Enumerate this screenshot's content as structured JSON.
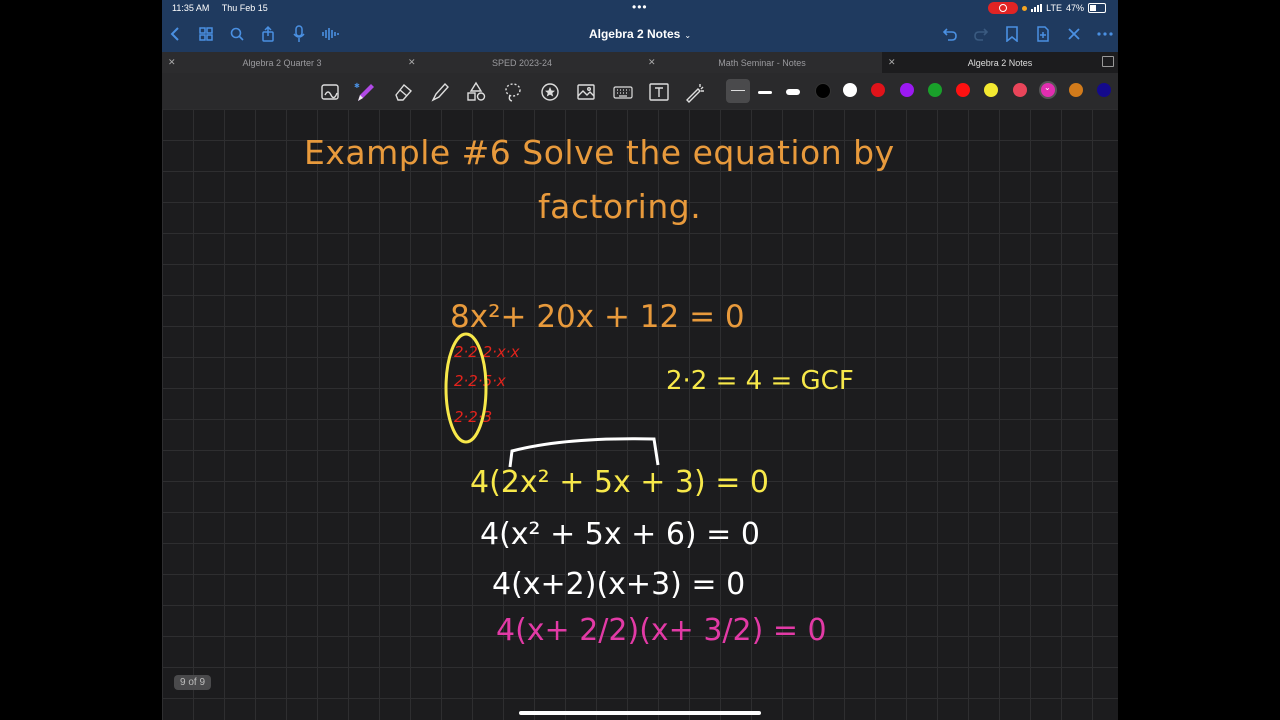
{
  "status_bar": {
    "time": "11:35 AM",
    "date": "Thu Feb 15",
    "network": "LTE",
    "battery": "47%"
  },
  "nav": {
    "title": "Algebra 2 Notes"
  },
  "tabs": [
    {
      "label": "Algebra 2 Quarter 3"
    },
    {
      "label": "SPED 2023-24"
    },
    {
      "label": "Math Seminar - Notes"
    },
    {
      "label": "Algebra 2 Notes"
    }
  ],
  "colors": {
    "accent": "#4a90e2",
    "ink_orange": "#e89a3c",
    "ink_yellow": "#f7e84a",
    "ink_red": "#e3231c",
    "ink_white": "#ffffff",
    "ink_magenta": "#e23aa6"
  },
  "palette": [
    "#000000",
    "#ffffff",
    "#e0131a",
    "#9b19f2",
    "#19a02a",
    "#ff1111",
    "#f3e931",
    "#e9455a",
    "#e12eb0",
    "#d27b1b",
    "#140a8c"
  ],
  "note": {
    "title_line1": "Example #6  Solve the equation by",
    "title_line2": "factoring.",
    "equation": "8x²+ 20x + 12 = 0",
    "factor1": "2·2·2·x·x",
    "factor2": "2·2·5·x",
    "factor3": "2·2·3",
    "gcf": "2·2 = 4 = GCF",
    "step1": "4(2x² + 5x + 3) = 0",
    "step2": "4(x² + 5x + 6) = 0",
    "step3": "4(x+2)(x+3) = 0",
    "step4": "4(x+ 2/2)(x+ 3/2) = 0"
  },
  "page_indicator": "9 of 9"
}
